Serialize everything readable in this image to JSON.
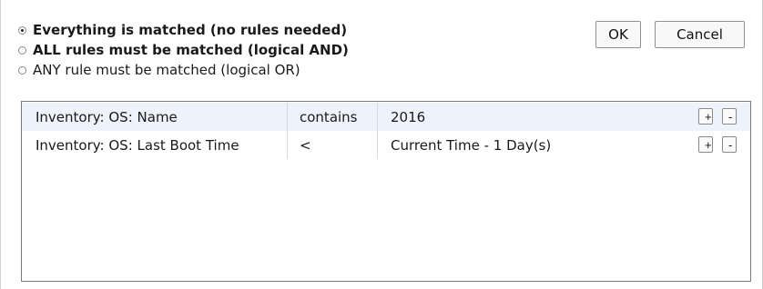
{
  "match_mode": {
    "options": [
      {
        "label": "Everything is matched (no rules needed)",
        "selected": true
      },
      {
        "label": "ALL rules must be matched (logical AND)",
        "selected": false
      },
      {
        "label": "ANY rule must be matched (logical OR)",
        "selected": false
      }
    ]
  },
  "buttons": {
    "ok_label": "OK",
    "cancel_label": "Cancel"
  },
  "rules": [
    {
      "field": "Inventory: OS: Name",
      "operator": "contains",
      "value": "2016",
      "add_label": "+",
      "remove_label": "-"
    },
    {
      "field": "Inventory: OS: Last Boot Time",
      "operator": "<",
      "value": "Current Time - 1 Day(s)",
      "add_label": "+",
      "remove_label": "-"
    }
  ],
  "colors": {
    "selected_row_bg": "#eef3fb",
    "border": "#7a7a7a"
  }
}
